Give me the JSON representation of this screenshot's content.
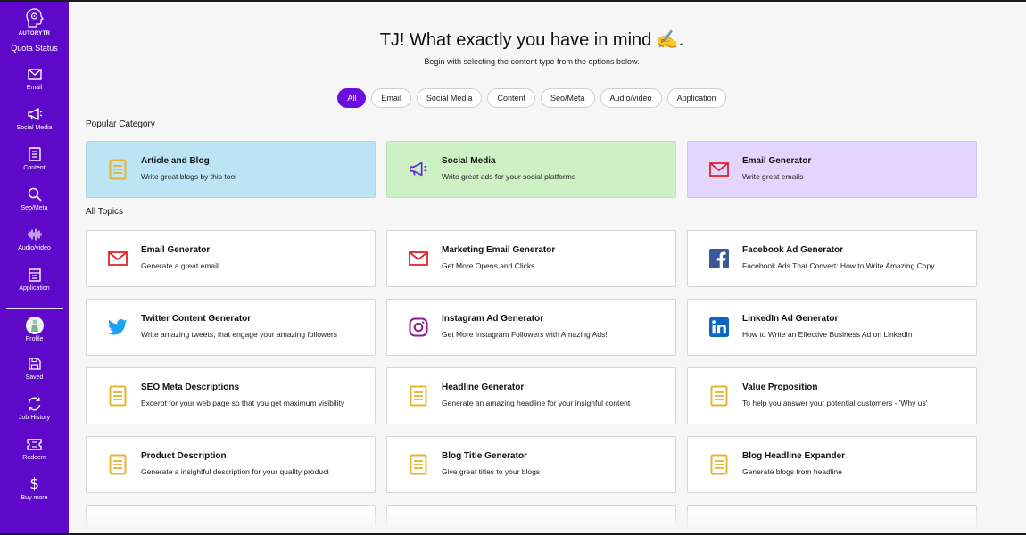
{
  "app": {
    "logo_text": "AUTORYTR",
    "quota_label": "Quota Status"
  },
  "sidebar": {
    "items": [
      {
        "label": "Email",
        "icon": "mail-icon"
      },
      {
        "label": "Social Media",
        "icon": "megaphone-icon"
      },
      {
        "label": "Content",
        "icon": "document-icon"
      },
      {
        "label": "Seo/Meta",
        "icon": "search-icon"
      },
      {
        "label": "Audio/video",
        "icon": "waveform-icon"
      },
      {
        "label": "Application",
        "icon": "application-icon"
      }
    ],
    "account": [
      {
        "label": "Profile",
        "icon": "avatar"
      },
      {
        "label": "Saved",
        "icon": "save-icon"
      },
      {
        "label": "Job History",
        "icon": "refresh-icon"
      },
      {
        "label": "Redeem",
        "icon": "ticket-icon"
      },
      {
        "label": "Buy more",
        "icon": "dollar-icon"
      }
    ]
  },
  "header": {
    "title": "TJ! What exactly you have in mind ✍️.",
    "subtitle": "Begin with selecting the content type from the options below."
  },
  "filters": [
    "All",
    "Email",
    "Social Media",
    "Content",
    "Seo/Meta",
    "Audio/video",
    "Application"
  ],
  "active_filter": "All",
  "popular": {
    "title": "Popular Category",
    "items": [
      {
        "title": "Article and Blog",
        "desc": "Write great blogs by this tool",
        "icon": "document-icon"
      },
      {
        "title": "Social Media",
        "desc": "Write great ads for your social platforms",
        "icon": "megaphone-icon"
      },
      {
        "title": "Email Generator",
        "desc": "Write great emails",
        "icon": "mail-icon"
      }
    ]
  },
  "topics": {
    "title": "All Topics",
    "items": [
      {
        "title": "Email Generator",
        "desc": "Generate a great email",
        "icon": "mail-icon"
      },
      {
        "title": "Marketing Email Generator",
        "desc": "Get More Opens and Clicks",
        "icon": "mail-icon"
      },
      {
        "title": "Facebook Ad Generator",
        "desc": "Facebook Ads That Convert: How to Write Amazing Copy",
        "icon": "facebook-icon"
      },
      {
        "title": "Twitter Content Generator",
        "desc": "Write amazing tweets, that engage your amazing followers",
        "icon": "twitter-icon"
      },
      {
        "title": "Instagram Ad Generator",
        "desc": "Get More Instagram Followers with Amazing Ads!",
        "icon": "instagram-icon"
      },
      {
        "title": "LinkedIn Ad Generator",
        "desc": "How to Write an Effective Business Ad on LinkedIn",
        "icon": "linkedin-icon"
      },
      {
        "title": "SEO Meta Descriptions",
        "desc": "Excerpt for your web page so that you get maximum visibility",
        "icon": "document-icon"
      },
      {
        "title": "Headline Generator",
        "desc": "Generate an amazing headline for your insighful content",
        "icon": "document-icon"
      },
      {
        "title": "Value Proposition",
        "desc": "To help you answer your potential customers - 'Why us'",
        "icon": "document-icon"
      },
      {
        "title": "Product Description",
        "desc": "Generate a insightful description for your quality product",
        "icon": "document-icon"
      },
      {
        "title": "Blog Title Generator",
        "desc": "Give great titles to your blogs",
        "icon": "document-icon"
      },
      {
        "title": "Blog Headline Expander",
        "desc": "Generate blogs from headline",
        "icon": "document-icon"
      }
    ]
  },
  "colors": {
    "sidebar": "#5e09c9",
    "accent": "#6a0ee0",
    "mail_red": "#e0242a",
    "doc_yellow": "#e7b52c",
    "megaphone_purple": "#5a2bd8",
    "facebook_blue": "#3b5998",
    "twitter_blue": "#1da1f2",
    "instagram_purple": "#8a1e8a",
    "linkedin_blue": "#0a66c2"
  }
}
